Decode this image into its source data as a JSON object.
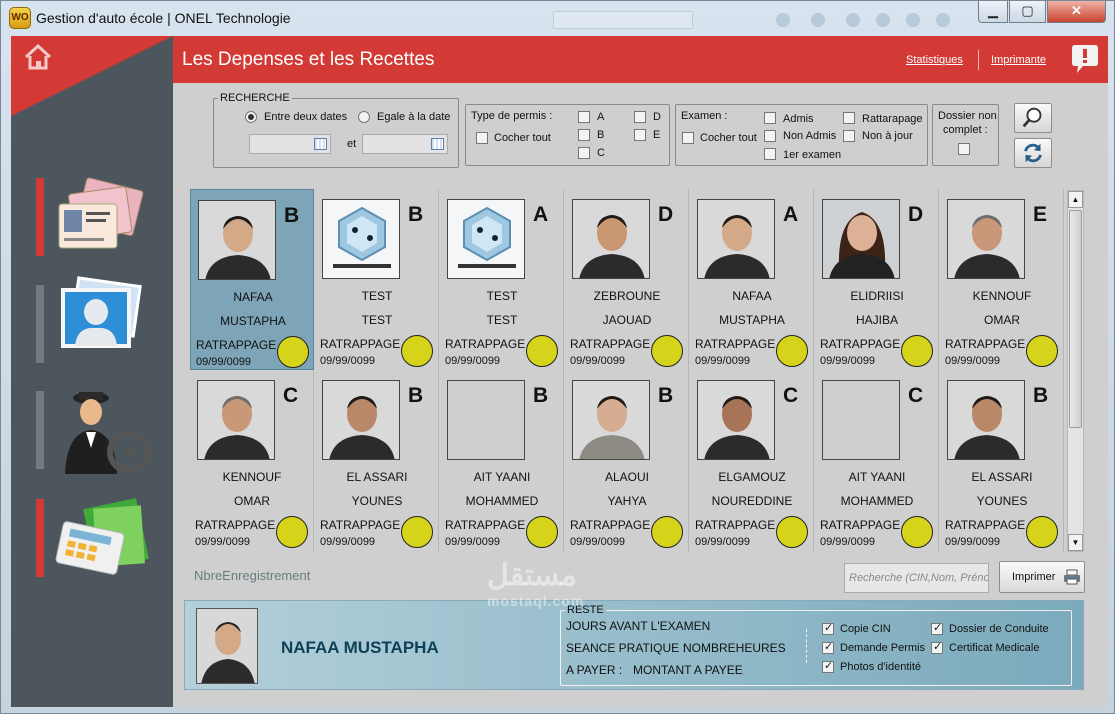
{
  "window": {
    "title": "Gestion d'auto école | ONEL Technologie",
    "app_icon": "WO",
    "minimize": "▁",
    "maximize": "▢",
    "close": "✕"
  },
  "header": {
    "title": "Les Depenses et les Recettes",
    "stats_link": "Statistiques",
    "print_link": "Imprimante"
  },
  "filters": {
    "recherche": {
      "legend": "RECHERCHE",
      "option1": "Entre deux dates",
      "option2": "Egale à la date",
      "et": "et"
    },
    "permis": {
      "legend": "Type de permis :",
      "cocher_tout": "Cocher tout",
      "a": "A",
      "b": "B",
      "c": "C",
      "d": "D",
      "e": "E"
    },
    "examen": {
      "legend": "Examen :",
      "cocher_tout": "Cocher tout",
      "admis": "Admis",
      "non_admis": "Non Admis",
      "premier": "1er examen",
      "rattarapage": "Rattarapage",
      "non_a_jour": "Non à jour"
    },
    "dossier": {
      "line1": "Dossier non",
      "line2": "complet :"
    }
  },
  "cards": [
    {
      "name1": "NAFAA",
      "name2": "MUSTAPHA",
      "permis": "B",
      "status": "RATRAPPAGE",
      "date": "09/99/0099",
      "photo": "man-1"
    },
    {
      "name1": "TEST",
      "name2": "TEST",
      "permis": "B",
      "status": "RATRAPPAGE",
      "date": "09/99/0099",
      "photo": "logo"
    },
    {
      "name1": "TEST",
      "name2": "TEST",
      "permis": "A",
      "status": "RATRAPPAGE",
      "date": "09/99/0099",
      "photo": "logo"
    },
    {
      "name1": "ZEBROUNE",
      "name2": "JAOUAD",
      "permis": "D",
      "status": "RATRAPPAGE",
      "date": "09/99/0099",
      "photo": "man-2"
    },
    {
      "name1": "NAFAA",
      "name2": "MUSTAPHA",
      "permis": "A",
      "status": "RATRAPPAGE",
      "date": "09/99/0099",
      "photo": "man-1"
    },
    {
      "name1": "ELIDRIISI",
      "name2": "HAJIBA",
      "permis": "D",
      "status": "RATRAPPAGE",
      "date": "09/99/0099",
      "photo": "woman"
    },
    {
      "name1": "KENNOUF",
      "name2": "OMAR",
      "permis": "E",
      "status": "RATRAPPAGE",
      "date": "09/99/0099",
      "photo": "man-3"
    },
    {
      "name1": "KENNOUF",
      "name2": "OMAR",
      "permis": "C",
      "status": "RATRAPPAGE",
      "date": "09/99/0099",
      "photo": "man-3"
    },
    {
      "name1": "EL ASSARI",
      "name2": "YOUNES",
      "permis": "B",
      "status": "RATRAPPAGE",
      "date": "09/99/0099",
      "photo": "man-4"
    },
    {
      "name1": "AIT YAANI",
      "name2": "MOHAMMED",
      "permis": "B",
      "status": "RATRAPPAGE",
      "date": "09/99/0099",
      "photo": "none"
    },
    {
      "name1": "ALAOUI",
      "name2": "YAHYA",
      "permis": "B",
      "status": "RATRAPPAGE",
      "date": "09/99/0099",
      "photo": "man-5"
    },
    {
      "name1": "ELGAMOUZ",
      "name2": "NOUREDDINE",
      "permis": "C",
      "status": "RATRAPPAGE",
      "date": "09/99/0099",
      "photo": "man-6"
    },
    {
      "name1": "AIT YAANI",
      "name2": "MOHAMMED",
      "permis": "C",
      "status": "RATRAPPAGE",
      "date": "09/99/0099",
      "photo": "none"
    },
    {
      "name1": "EL ASSARI",
      "name2": "YOUNES",
      "permis": "B",
      "status": "RATRAPPAGE",
      "date": "09/99/0099",
      "photo": "man-4"
    }
  ],
  "footer": {
    "count_label": "NbreEnregistrement",
    "search_placeholder": "Recherche (CIN,Nom, Prénom)",
    "print_button": "Imprimer"
  },
  "detail": {
    "name": "NAFAA MUSTAPHA",
    "reste": {
      "legend": "RESTE",
      "line1": "JOURS AVANT L'EXAMEN",
      "line2_label": "SEANCE PRATIQUE :",
      "line2_value": "NOMBREHEURES",
      "line3_label": "A PAYER :",
      "line3_value": "MONTANT A PAYEE"
    },
    "checks": {
      "copie_cin": "Copie CIN",
      "demande_permis": "Demande Permis",
      "photos": "Photos d'identité",
      "dossier_conduite": "Dossier de Conduite",
      "certificat": "Certificat Medicale"
    }
  },
  "watermark": {
    "line1": "مستقل",
    "line2": "mostaql.com"
  },
  "colors": {
    "accent_red": "#d33a35",
    "sidebar": "#4c565c",
    "selected_card": "#7ea4b7",
    "status_circle": "#d5d41a",
    "detail_panel": "#7aaabc"
  }
}
